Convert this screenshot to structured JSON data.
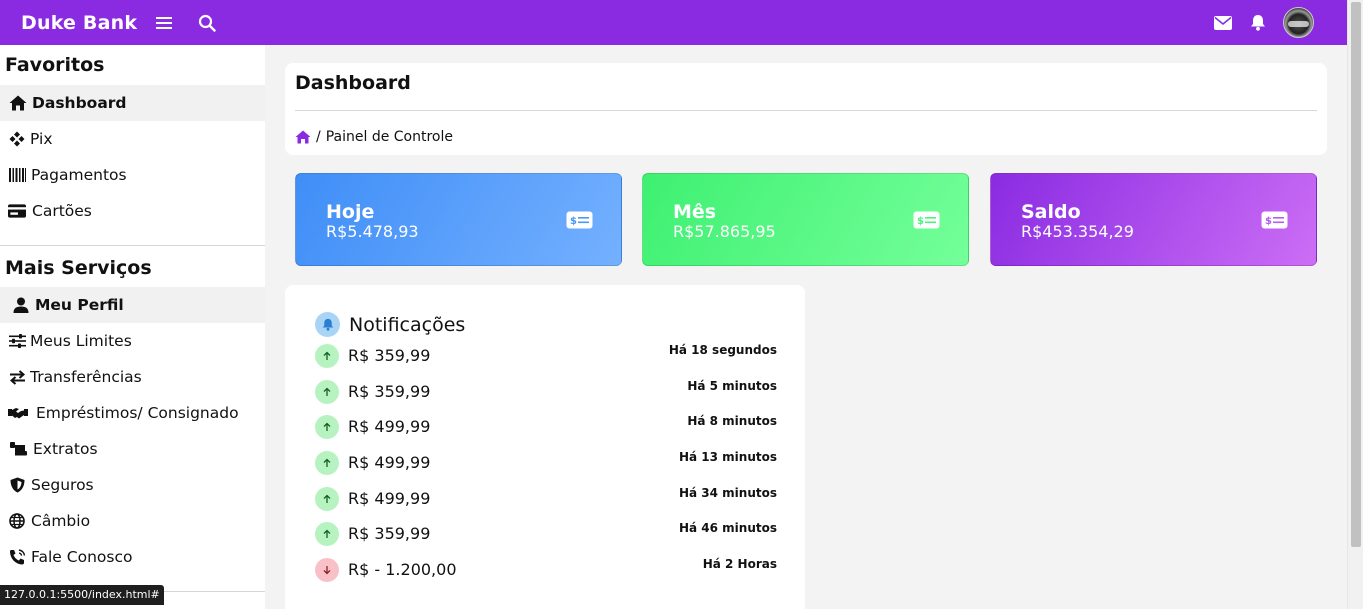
{
  "topbar": {
    "brand": "Duke Bank",
    "icons": [
      "menu-icon",
      "search-icon",
      "mail-icon",
      "bell-icon",
      "avatar"
    ],
    "color": "#8a2be2"
  },
  "sidebar": {
    "favorites_title": "Favoritos",
    "favorites": [
      {
        "label": "Dashboard",
        "icon": "home-icon",
        "active": true
      },
      {
        "label": "Pix",
        "icon": "pix-icon",
        "active": false
      },
      {
        "label": "Pagamentos",
        "icon": "barcode-icon",
        "active": false
      },
      {
        "label": "Cartões",
        "icon": "card-icon",
        "active": false
      }
    ],
    "services_title": "Mais Serviços",
    "services": [
      {
        "label": "Meu Perfil",
        "icon": "user-icon",
        "active": true
      },
      {
        "label": "Meus Limites",
        "icon": "sliders-icon",
        "active": false
      },
      {
        "label": "Transferências",
        "icon": "transfer-icon",
        "active": false
      },
      {
        "label": "Empréstimos/ Consignado",
        "icon": "handshake-icon",
        "active": false
      },
      {
        "label": "Extratos",
        "icon": "receipt-icon",
        "active": false
      },
      {
        "label": "Seguros",
        "icon": "shield-icon",
        "active": false
      },
      {
        "label": "Câmbio",
        "icon": "globe-icon",
        "active": false
      },
      {
        "label": "Fale Conosco",
        "icon": "phone-icon",
        "active": false
      }
    ]
  },
  "main": {
    "title": "Dashboard",
    "breadcrumb": {
      "home_icon": "home-icon",
      "separator": "/",
      "current": "Painel de Controle"
    },
    "cards": [
      {
        "label": "Hoje",
        "value": "R$5.478,93",
        "icon": "money-icon",
        "color": "#3f8ef7"
      },
      {
        "label": "Mês",
        "value": "R$57.865,95",
        "icon": "money-icon",
        "color": "#3ef071"
      },
      {
        "label": "Saldo",
        "value": "R$453.354,29",
        "icon": "money-icon",
        "color": "#8a2be2"
      }
    ],
    "notifications": {
      "title": "Notificações",
      "items": [
        {
          "amount": "R$ 359,99",
          "time": "Há 18 segundos",
          "direction": "up"
        },
        {
          "amount": "R$ 359,99",
          "time": "Há 5 minutos",
          "direction": "up"
        },
        {
          "amount": "R$ 499,99",
          "time": "Há 8 minutos",
          "direction": "up"
        },
        {
          "amount": "R$ 499,99",
          "time": "Há 13 minutos",
          "direction": "up"
        },
        {
          "amount": "R$ 499,99",
          "time": "Há 34 minutos",
          "direction": "up"
        },
        {
          "amount": "R$ 359,99",
          "time": "Há 46 minutos",
          "direction": "up"
        },
        {
          "amount": "R$ - 1.200,00",
          "time": "Há 2 Horas",
          "direction": "down"
        }
      ]
    }
  },
  "status_bar": {
    "url": "127.0.0.1:5500/index.html#"
  }
}
